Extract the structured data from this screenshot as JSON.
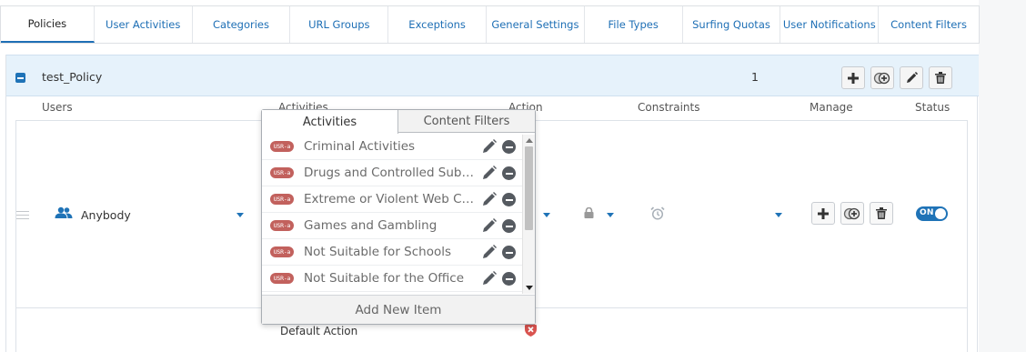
{
  "tabs": [
    {
      "label": "Policies"
    },
    {
      "label": "User Activities"
    },
    {
      "label": "Categories"
    },
    {
      "label": "URL Groups"
    },
    {
      "label": "Exceptions"
    },
    {
      "label": "General Settings"
    },
    {
      "label": "File Types"
    },
    {
      "label": "Surfing Quotas"
    },
    {
      "label": "User Notifications"
    },
    {
      "label": "Content Filters"
    }
  ],
  "active_tab": "Policies",
  "policy": {
    "name": "test_Policy",
    "count": "1"
  },
  "columns": {
    "users": "Users",
    "activities": "Activities",
    "action": "Action",
    "constraints": "Constraints",
    "manage": "Manage",
    "status": "Status"
  },
  "rule": {
    "user": "Anybody",
    "status": "ON",
    "default_action": "Default Action"
  },
  "popup": {
    "tabs": [
      "Activities",
      "Content Filters"
    ],
    "active_tab": "Activities",
    "badge": "USR-a",
    "items": [
      {
        "label": "Criminal Activities"
      },
      {
        "label": "Drugs and Controlled Subst…"
      },
      {
        "label": "Extreme or Violent Web Con…"
      },
      {
        "label": "Games and Gambling"
      },
      {
        "label": "Not Suitable for Schools"
      },
      {
        "label": "Not Suitable for the Office"
      }
    ],
    "footer": "Add New Item"
  },
  "colors": {
    "accent": "#1f73b7",
    "header_bg": "#e6f2fb",
    "badge": "#c2615d",
    "deny": "#d9534f"
  },
  "icons": {
    "add": "plus-icon",
    "clone": "clone-icon",
    "edit": "pencil-icon",
    "delete": "trash-icon",
    "users": "users-icon",
    "lock": "lock-icon",
    "alarm": "alarm-clock-icon",
    "deny": "shield-x-icon"
  }
}
